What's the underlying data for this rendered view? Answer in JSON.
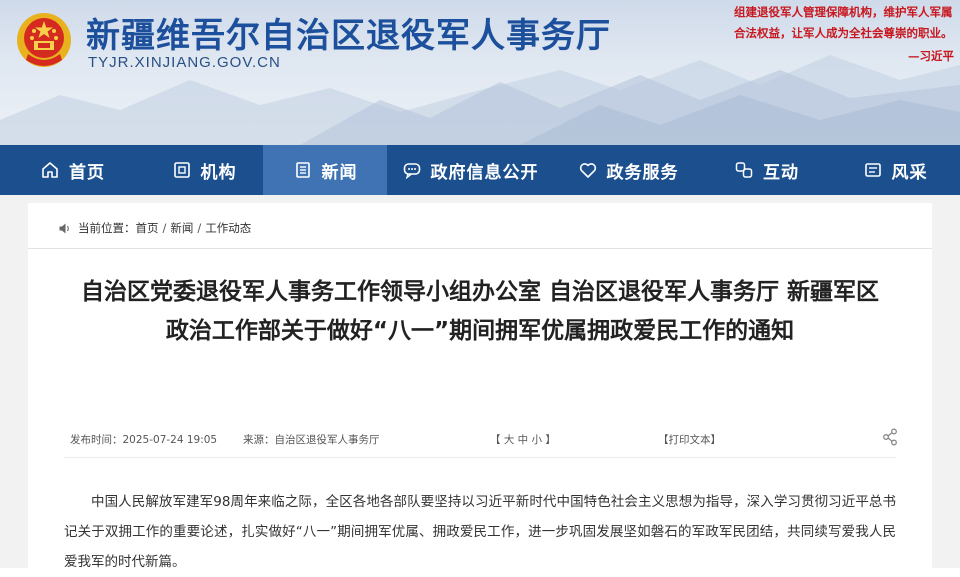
{
  "header": {
    "site_title": "新疆维吾尔自治区退役军人事务厅",
    "site_url": "TYJR.XINJIANG.GOV.CN",
    "quote_text": "组建退役军人管理保障机构，维护军人军属合法权益，让军人成为全社会尊崇的职业。",
    "quote_signature": "—习近平",
    "emblem_icon": "national-emblem-icon"
  },
  "nav": {
    "items": [
      {
        "label": "首页",
        "icon": "home-icon"
      },
      {
        "label": "机构",
        "icon": "building-icon"
      },
      {
        "label": "新闻",
        "icon": "news-icon",
        "active": true
      },
      {
        "label": "政府信息公开",
        "icon": "chat-icon"
      },
      {
        "label": "政务服务",
        "icon": "heart-icon"
      },
      {
        "label": "互动",
        "icon": "interaction-icon"
      },
      {
        "label": "风采",
        "icon": "gallery-icon"
      }
    ],
    "colors": {
      "bar": "#1b4f8e",
      "active": "#3f73b3"
    }
  },
  "breadcrumb": {
    "prefix": "当前位置：",
    "items": [
      "首页",
      "新闻",
      "工作动态"
    ],
    "separator": "/"
  },
  "article": {
    "title": "自治区党委退役军人事务工作领导小组办公室 自治区退役军人事务厅 新疆军区政治工作部关于做好“八一”期间拥军优属拥政爱民工作的通知",
    "publish_time": "发布时间：2025-07-24 19:05",
    "source": "来源：自治区退役军人事务厅",
    "font_size_control": "【 大  中  小 】",
    "print_label": "【打印文本】",
    "body": "中国人民解放军建军98周年来临之际，全区各地各部队要坚持以习近平新时代中国特色社会主义思想为指导，深入学习贯彻习近平总书记关于双拥工作的重要论述，扎实做好“八一”期间拥军优属、拥政爱民工作，进一步巩固发展坚如磐石的军政军民团结，共同续写爱我人民爱我军的时代新篇。"
  }
}
